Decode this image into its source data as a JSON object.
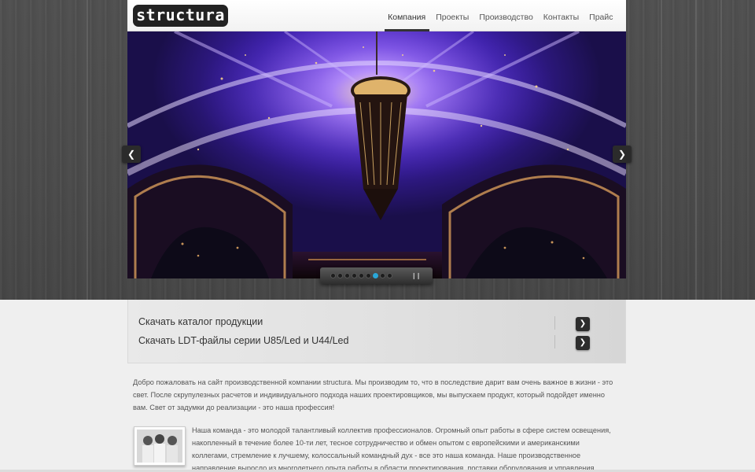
{
  "logo": {
    "text": "structura"
  },
  "nav": {
    "items": [
      {
        "label": "Компания",
        "active": true
      },
      {
        "label": "Проекты"
      },
      {
        "label": "Производство"
      },
      {
        "label": "Контакты"
      },
      {
        "label": "Прайс"
      }
    ]
  },
  "slider": {
    "prev_icon": "chevron-left-icon",
    "next_icon": "chevron-right-icon",
    "slide_count": 9,
    "active_slide": 7,
    "pause_icon": "pause-icon"
  },
  "downloads": {
    "items": [
      {
        "label": "Скачать каталог продукции"
      },
      {
        "label": "Скачать LDT-файлы серии U85/Led и U44/Led"
      }
    ]
  },
  "content": {
    "intro": "Добро пожаловать на сайт производственной компании structura. Мы производим то, что в последствие дарит вам очень важное в жизни - это свет. После скрупулезных расчетов и индивидуального подхода наших проектировщиков, мы выпускаем продукт, который подойдет именно вам. Свет от задумки до реализации - это наша профессия!",
    "team": "Наша команда - это молодой талантливый коллектив профессионалов. Огромный опыт работы в сфере систем освещения, накопленный в течение более 10-ти лет, тесное сотрудничество и обмен опытом с европейскими и американскими коллегами, стремление к лучшему, колоссальный командный дух - все это наша команда. Наше производственное направление выросло из многолетнего опыта работы в области проектирования, поставки оборудования и управления проектами."
  },
  "colors": {
    "accent": "#2aa7d8",
    "dark": "#222222",
    "background": "#efefef"
  }
}
